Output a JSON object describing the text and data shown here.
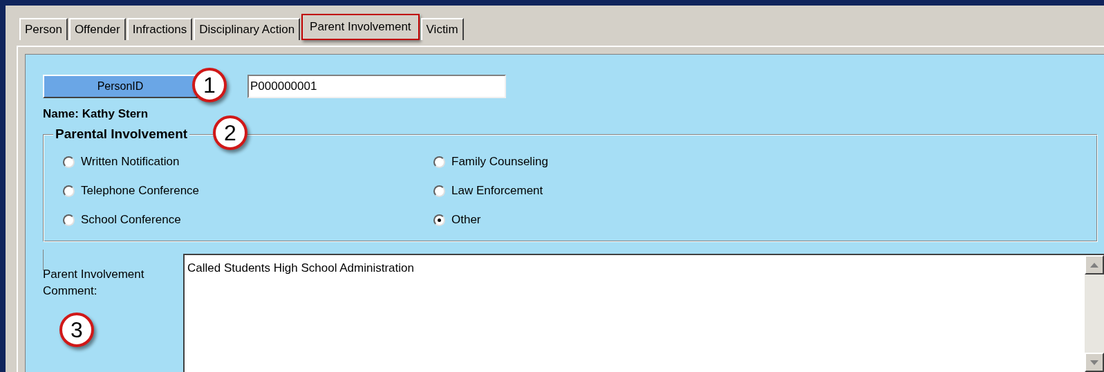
{
  "tabs": [
    {
      "label": "Person",
      "selected": false
    },
    {
      "label": "Offender",
      "selected": false
    },
    {
      "label": "Infractions",
      "selected": false
    },
    {
      "label": "Disciplinary Action",
      "selected": false
    },
    {
      "label": "Parent Involvement",
      "selected": true
    },
    {
      "label": "Victim",
      "selected": false
    }
  ],
  "person_id": {
    "button": "PersonID",
    "value": "P000000001"
  },
  "name": "Name: Kathy Stern",
  "group": {
    "title": "Parental Involvement",
    "options": [
      {
        "label": "Written Notification",
        "selected": false
      },
      {
        "label": "Telephone Conference",
        "selected": false
      },
      {
        "label": "School Conference",
        "selected": false
      },
      {
        "label": "Family Counseling",
        "selected": false
      },
      {
        "label": "Law Enforcement",
        "selected": false
      },
      {
        "label": "Other",
        "selected": true
      }
    ]
  },
  "comment": {
    "label": "Parent Involvement Comment:",
    "value": "Called Students High School Administration"
  },
  "callouts": [
    "1",
    "2",
    "3"
  ]
}
